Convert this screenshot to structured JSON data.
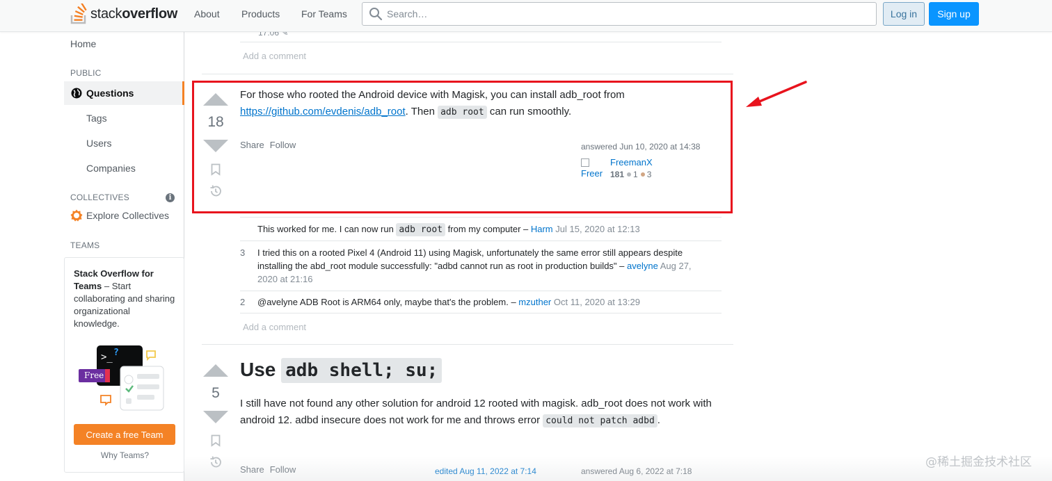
{
  "header": {
    "logo_light": "stack",
    "logo_bold": "overflow",
    "nav": [
      "About",
      "Products",
      "For Teams"
    ],
    "search_placeholder": "Search…",
    "login_label": "Log in",
    "signup_label": "Sign up"
  },
  "sidebar": {
    "home": "Home",
    "public_heading": "PUBLIC",
    "questions": "Questions",
    "items": [
      "Tags",
      "Users",
      "Companies"
    ],
    "collectives_heading": "COLLECTIVES",
    "collectives_info": "i",
    "explore_collectives": "Explore Collectives",
    "teams_heading": "TEAMS",
    "teams_promo_bold": "Stack Overflow for Teams",
    "teams_promo_rest": " – Start collaborating and sharing organizational knowledge.",
    "free_tag": "Free",
    "create_team_button": "Create a free Team",
    "why_teams": "Why Teams?"
  },
  "main": {
    "prev_timestamp": "17:06",
    "add_comment_label": "Add a comment",
    "answer1": {
      "score": "18",
      "body_before_link": "For those who rooted the Android device with Magisk, you can install adb_root from ",
      "link": "https://github.com/evdenis/adb_root",
      "body_after_link": ". Then ",
      "code": "adb root",
      "body_end": " can run smoothly.",
      "share": "Share",
      "follow": "Follow",
      "answered": "answered Jun 10, 2020 at 14:38",
      "user": {
        "avatar_alt": "Freer",
        "name": "FreemanX",
        "reputation": "181",
        "silver": "1",
        "bronze": "3"
      },
      "comments": [
        {
          "score": "",
          "text_before": "This worked for me. I can now run ",
          "code": "adb root",
          "text_after": " from my computer – ",
          "user": "Harm",
          "date": "Jul 15, 2020 at 12:13"
        },
        {
          "score": "3",
          "text": "I tried this on a rooted Pixel 4 (Android 11) using Magisk, unfortunately the same error still appears despite installing the abd_root module successfully: \"adbd cannot run as root in production builds\" – ",
          "user": "avelyne",
          "date": "Aug 27, 2020 at 21:16"
        },
        {
          "score": "2",
          "text": "@avelyne ADB Root is ARM64 only, maybe that's the problem. – ",
          "user": "mzuther",
          "date": "Oct 11, 2020 at 13:29"
        }
      ]
    },
    "answer2": {
      "score": "5",
      "title_word": "Use",
      "title_code": "adb shell; su;",
      "body": "I still have not found any other solution for android 12 rooted with magisk. adb_root does not work with android 12. adbd insecure does not work for me and throws error ",
      "code": "could not patch adbd",
      "body_end": ".",
      "share": "Share",
      "follow": "Follow",
      "edited": "edited Aug 11, 2022 at 7:14",
      "answered": "answered Aug 6, 2022 at 7:18"
    }
  },
  "watermark": "@稀土掘金技术社区",
  "colors": {
    "accent_orange": "#f48225",
    "link_blue": "#0074cc",
    "signup_blue": "#0a95ff",
    "highlight_red": "#e8131d"
  }
}
